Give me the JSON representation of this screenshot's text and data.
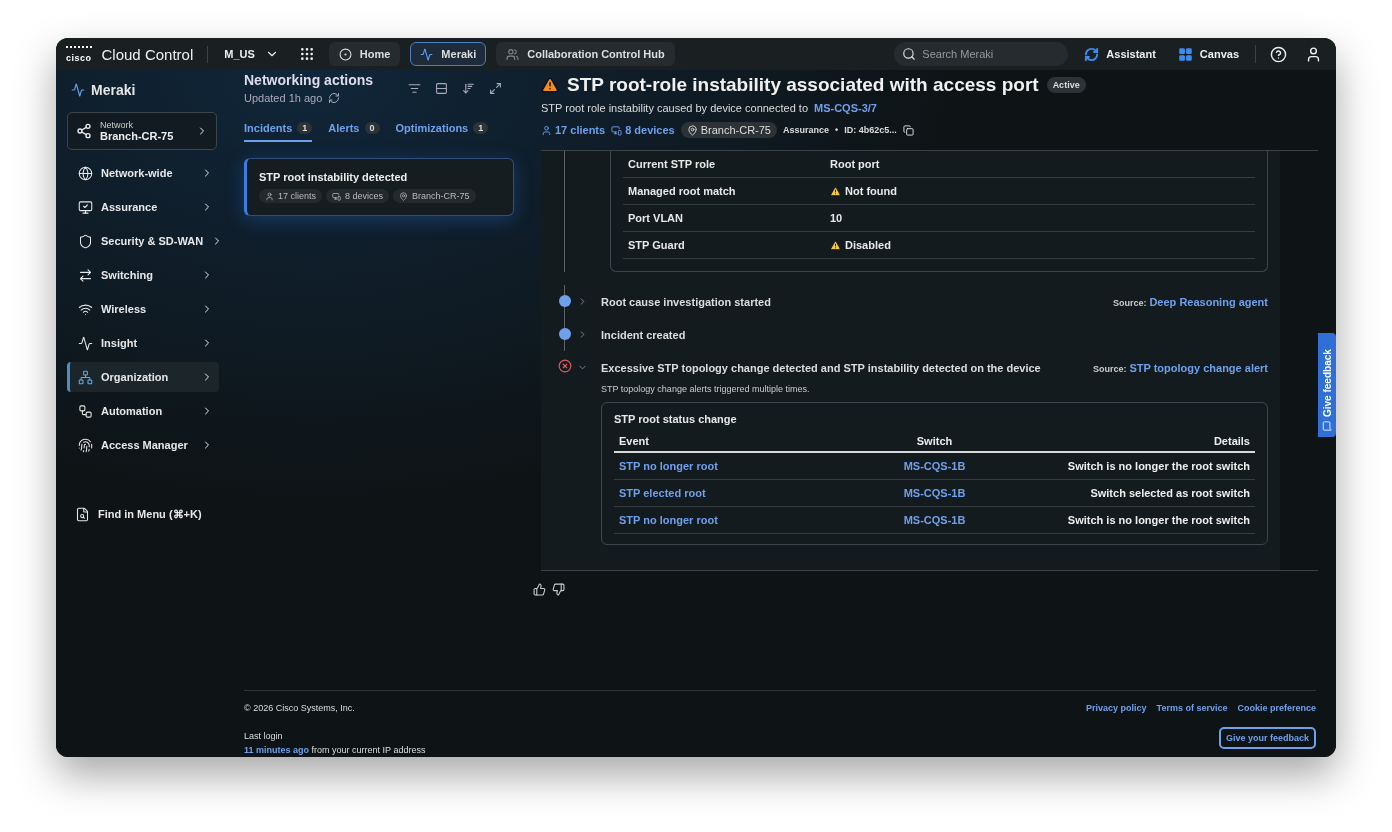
{
  "topbar": {
    "logo_text": "cisco",
    "brand": "Cloud Control",
    "org": "M_US",
    "apps": [
      {
        "label": "Home",
        "kind": "home",
        "selected": false
      },
      {
        "label": "Meraki",
        "kind": "meraki",
        "selected": true
      },
      {
        "label": "Collaboration Control Hub",
        "kind": "collab",
        "selected": false
      }
    ],
    "search": {
      "placeholder": "Search Meraki"
    },
    "actions": [
      {
        "label": "Assistant",
        "kind": "assistant"
      },
      {
        "label": "Canvas",
        "kind": "canvas"
      }
    ]
  },
  "sidebar": {
    "product": "Meraki",
    "network": {
      "label": "Network",
      "value": "Branch-CR-75"
    },
    "items": [
      {
        "label": "Network-wide",
        "kind": "globe",
        "selected": false
      },
      {
        "label": "Assurance",
        "kind": "assurance",
        "selected": false
      },
      {
        "label": "Security & SD-WAN",
        "kind": "shield",
        "selected": false
      },
      {
        "label": "Switching",
        "kind": "switch",
        "selected": false
      },
      {
        "label": "Wireless",
        "kind": "wifi",
        "selected": false
      },
      {
        "label": "Insight",
        "kind": "insight",
        "selected": false
      },
      {
        "label": "Organization",
        "kind": "org",
        "selected": true
      },
      {
        "label": "Automation",
        "kind": "automation",
        "selected": false
      },
      {
        "label": "Access Manager",
        "kind": "fingerprint",
        "selected": false
      }
    ],
    "find": "Find in Menu (⌘+K)"
  },
  "actions_panel": {
    "title": "Networking actions",
    "updated": "Updated 1h ago",
    "tabs": [
      {
        "label": "Incidents",
        "count": "1",
        "selected": true
      },
      {
        "label": "Alerts",
        "count": "0",
        "selected": false
      },
      {
        "label": "Optimizations",
        "count": "1",
        "selected": false
      }
    ],
    "incidents": [
      {
        "title": "STP root instability detected",
        "clients": "17 clients",
        "devices": "8 devices",
        "location": "Branch-CR-75",
        "selected": true
      }
    ]
  },
  "incident": {
    "title": "STP root-role instability associated with access port",
    "status": "Active",
    "summary": "STP root role instability caused by device connected to",
    "device": "MS-CQS-3/7",
    "clients": "17 clients",
    "devices": "8 devices",
    "location": "Branch-CR-75",
    "category": "Assurance",
    "separator": "•",
    "id": "ID: 4b62c5...",
    "details": [
      {
        "label": "Current STP role",
        "value": "Root port",
        "warning": false
      },
      {
        "label": "Managed root match",
        "value": "Not found",
        "warning": true
      },
      {
        "label": "Port VLAN",
        "value": "10",
        "warning": false
      },
      {
        "label": "STP Guard",
        "value": "Disabled",
        "warning": true
      }
    ],
    "timeline": [
      {
        "title": "Root cause investigation started",
        "kind": "info",
        "expanded": false,
        "source_label": "Source:",
        "source": "Deep Reasoning agent"
      },
      {
        "title": "Incident created",
        "kind": "info",
        "expanded": false
      },
      {
        "title": "Excessive STP topology change detected and STP instability detected on the device",
        "kind": "error",
        "expanded": true,
        "source_label": "Source:",
        "source": "STP topology change alert",
        "description": "STP topology change alerts triggered multiple times.",
        "table": {
          "title": "STP root status change",
          "columns": [
            "Event",
            "Switch",
            "Details"
          ],
          "rows": [
            [
              "STP no longer root",
              "MS-CQS-1B",
              "Switch is no longer the root switch"
            ],
            [
              "STP elected root",
              "MS-CQS-1B",
              "Switch selected as root switch"
            ],
            [
              "STP no longer root",
              "MS-CQS-1B",
              "Switch is no longer the root switch"
            ]
          ]
        }
      }
    ]
  },
  "side_tab": "Give feedback",
  "footer": {
    "copyright": "© 2026 Cisco Systems, Inc.",
    "links": [
      "Privacy policy",
      "Terms of service",
      "Cookie preference"
    ],
    "last_login": "Last login",
    "login_time": "11 minutes ago",
    "login_rest": "from your current IP address",
    "feedback_button": "Give your feedback"
  }
}
